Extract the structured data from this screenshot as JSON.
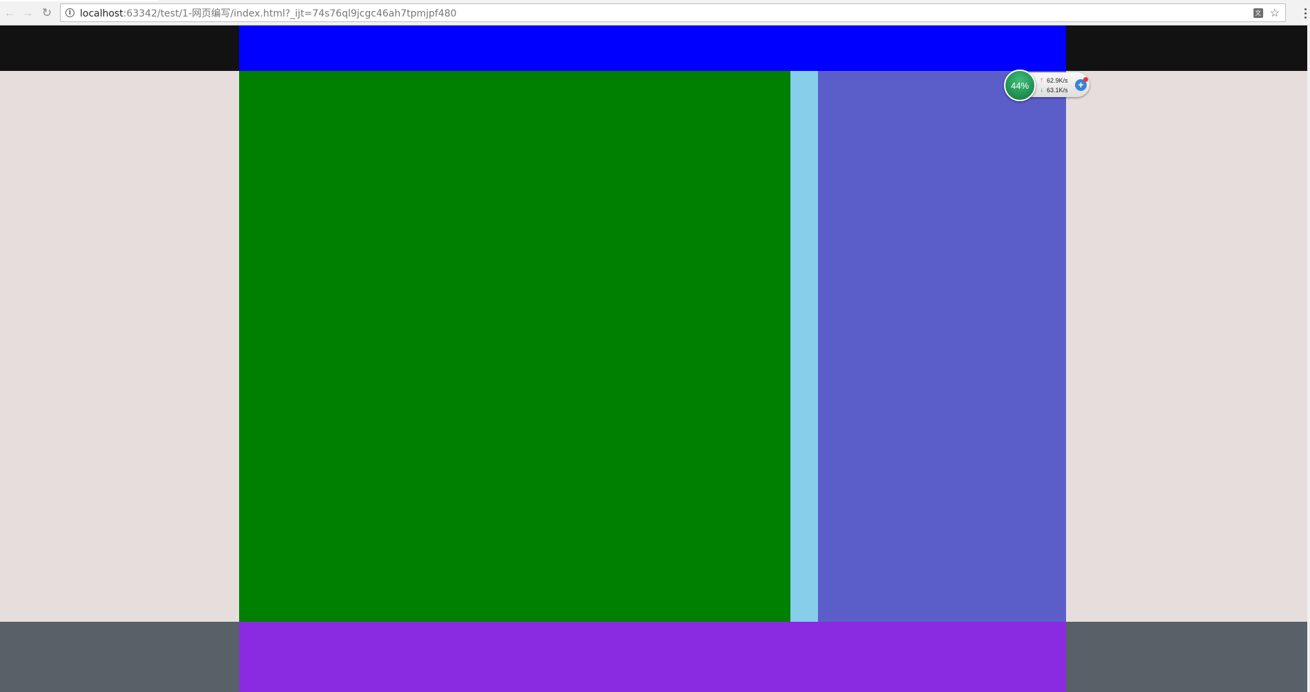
{
  "browser": {
    "url_host": "localhost",
    "url_rest": ":63342/test/1-网页编写/index.html?_ijt=74s76ql9jcgc46ah7tpmjpf480",
    "back_icon": "back-arrow-icon",
    "forward_icon": "forward-arrow-icon",
    "reload_icon": "reload-icon"
  },
  "net_monitor": {
    "percent": "44%",
    "upload": "62.9K/s",
    "download": "63.1K/s"
  },
  "colors": {
    "header_band": "#121212",
    "body_band": "#e6dedd",
    "footer_band": "#586068",
    "header_block": "#0000ff",
    "main_block": "#008000",
    "gap_block": "#87ceeb",
    "side_block": "#5b5ec8",
    "footer_block": "#8a2be2"
  }
}
